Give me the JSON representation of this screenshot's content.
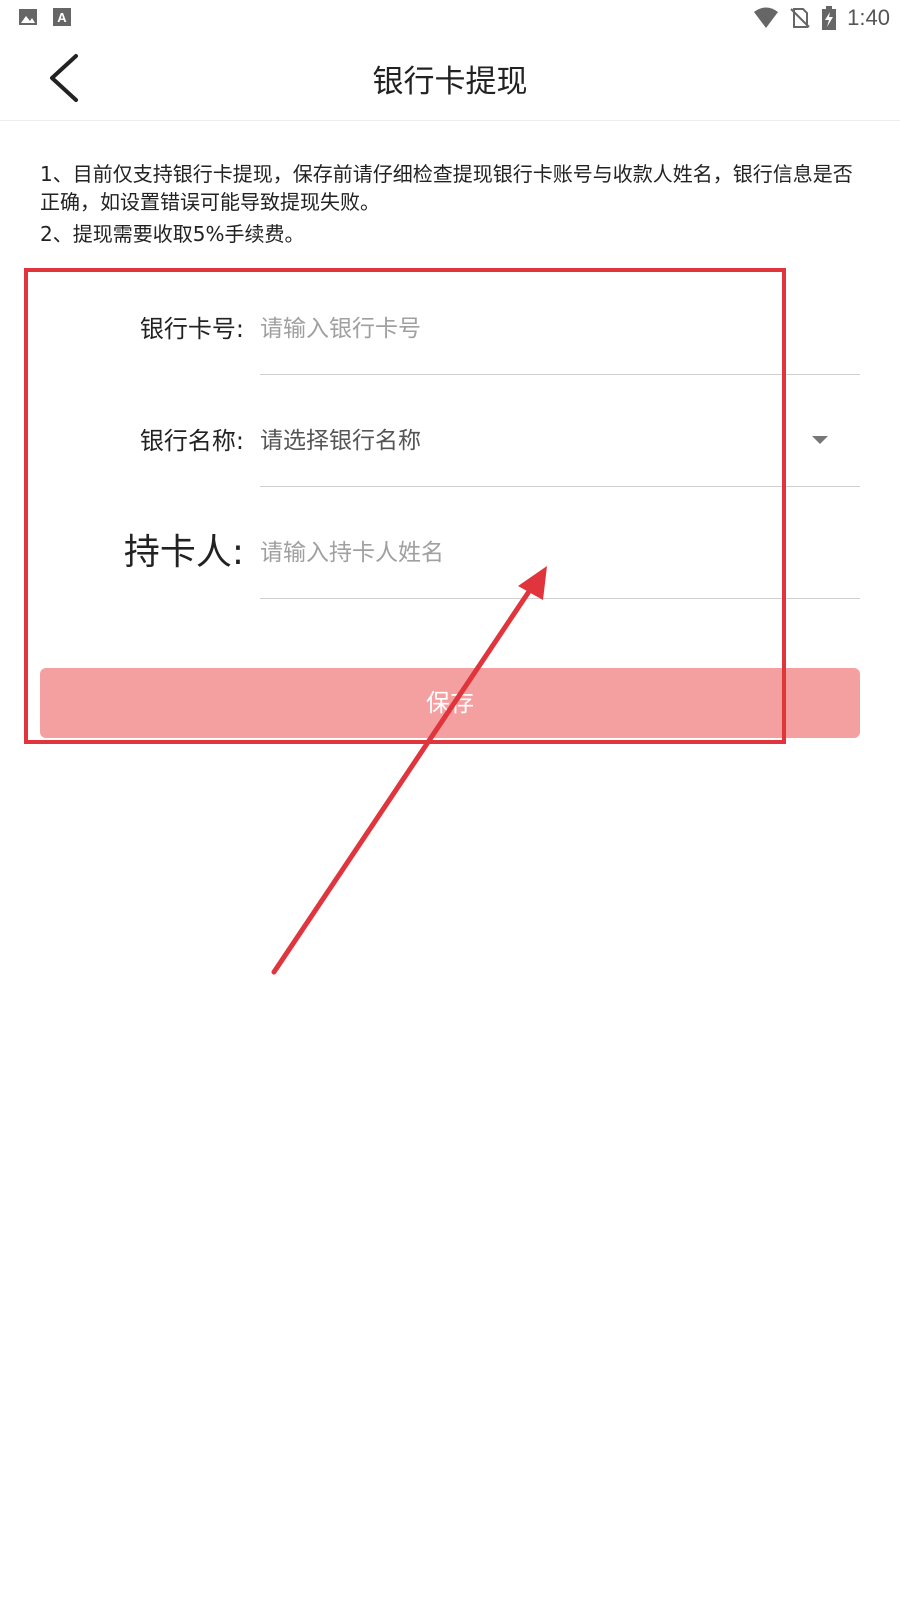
{
  "status_bar": {
    "time": "1:40",
    "left_icons": [
      "image-icon",
      "text-a-icon"
    ],
    "right_icons": [
      "wifi-icon",
      "no-sim-icon",
      "battery-charging-icon"
    ]
  },
  "app_bar": {
    "title": "银行卡提现",
    "back_icon": "chevron-left-icon"
  },
  "notice": {
    "line1": "1、目前仅支持银行卡提现，保存前请仔细检查提现银行卡账号与收款人姓名，银行信息是否正确，如设置错误可能导致提现失败。",
    "line2": "2、提现需要收取5%手续费。"
  },
  "form": {
    "card_number": {
      "label": "银行卡号:",
      "value": "",
      "placeholder": "请输入银行卡号"
    },
    "bank_name": {
      "label": "银行名称:",
      "selected": "请选择银行名称"
    },
    "card_holder": {
      "label": "持卡人:",
      "value": "",
      "placeholder": "请输入持卡人姓名"
    }
  },
  "save_button": {
    "label": "保存"
  },
  "colors": {
    "save_button_bg": "#f5a0a0",
    "annotation": "#e0353c",
    "divider": "#cfcfcf"
  }
}
